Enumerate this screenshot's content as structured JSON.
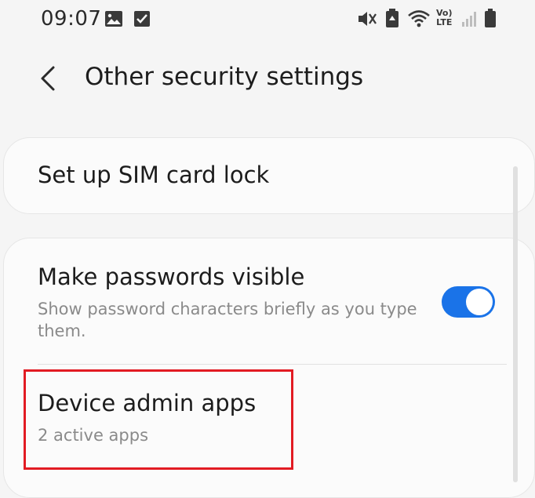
{
  "status_bar": {
    "time": "09:07",
    "left_icons": [
      "gallery-icon",
      "checkbox-icon"
    ],
    "right_icons": [
      "mute-vibrate-icon",
      "battery-saver-icon",
      "wifi-icon",
      "volte-lte-icon",
      "signal-icon",
      "battery-icon"
    ],
    "volte_label": "Vo)\nLTE"
  },
  "app_bar": {
    "title": "Other security settings"
  },
  "settings": {
    "sim_lock": {
      "title": "Set up SIM card lock"
    },
    "passwords_visible": {
      "title": "Make passwords visible",
      "subtitle": "Show password characters briefly as you type them.",
      "enabled": true
    },
    "device_admin": {
      "title": "Device admin apps",
      "subtitle": "2 active apps"
    }
  },
  "colors": {
    "accent": "#1a73e8",
    "highlight": "#e21b23",
    "background": "#f5f5f5",
    "card": "#fbfbfb"
  }
}
